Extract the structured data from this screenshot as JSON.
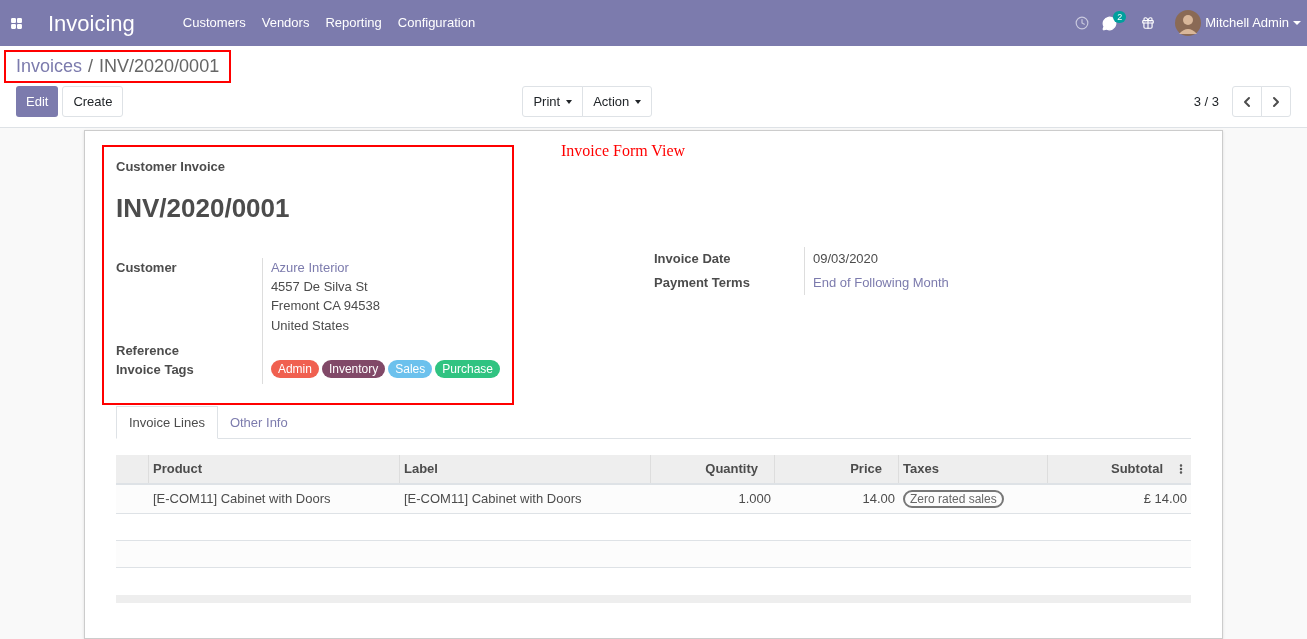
{
  "navbar": {
    "app_name": "Invoicing",
    "menu": [
      "Customers",
      "Vendors",
      "Reporting",
      "Configuration"
    ],
    "message_count": "2",
    "user": "Mitchell Admin"
  },
  "breadcrumb": {
    "parent": "Invoices",
    "separator": "/",
    "current": "INV/2020/0001"
  },
  "buttons": {
    "edit": "Edit",
    "create": "Create",
    "print": "Print",
    "action": "Action"
  },
  "pager": "3 / 3",
  "annotation": "Invoice Form View",
  "form": {
    "type_label": "Customer Invoice",
    "number": "INV/2020/0001",
    "customer_label": "Customer",
    "customer": "Azure Interior",
    "address": [
      "4557 De Silva St",
      "Fremont CA 94538",
      "United States"
    ],
    "reference_label": "Reference",
    "tags_label": "Invoice Tags",
    "tags": [
      {
        "label": "Admin",
        "color": "#f06050"
      },
      {
        "label": "Inventory",
        "color": "#814968"
      },
      {
        "label": "Sales",
        "color": "#6cc1ed"
      },
      {
        "label": "Purchase",
        "color": "#30c381"
      }
    ],
    "invoice_date_label": "Invoice Date",
    "invoice_date": "09/03/2020",
    "payment_terms_label": "Payment Terms",
    "payment_terms": "End of Following Month"
  },
  "tabs": [
    {
      "label": "Invoice Lines",
      "selected": true
    },
    {
      "label": "Other Info",
      "selected": false
    }
  ],
  "table": {
    "columns": [
      "Product",
      "Label",
      "Quantity",
      "Price",
      "Taxes",
      "Subtotal"
    ],
    "rows": [
      {
        "product": "[E-COM11] Cabinet with Doors",
        "label": "[E-COM11] Cabinet with Doors",
        "quantity": "1.000",
        "price": "14.00",
        "tax": "Zero rated sales",
        "subtotal": "£ 14.00"
      }
    ]
  }
}
